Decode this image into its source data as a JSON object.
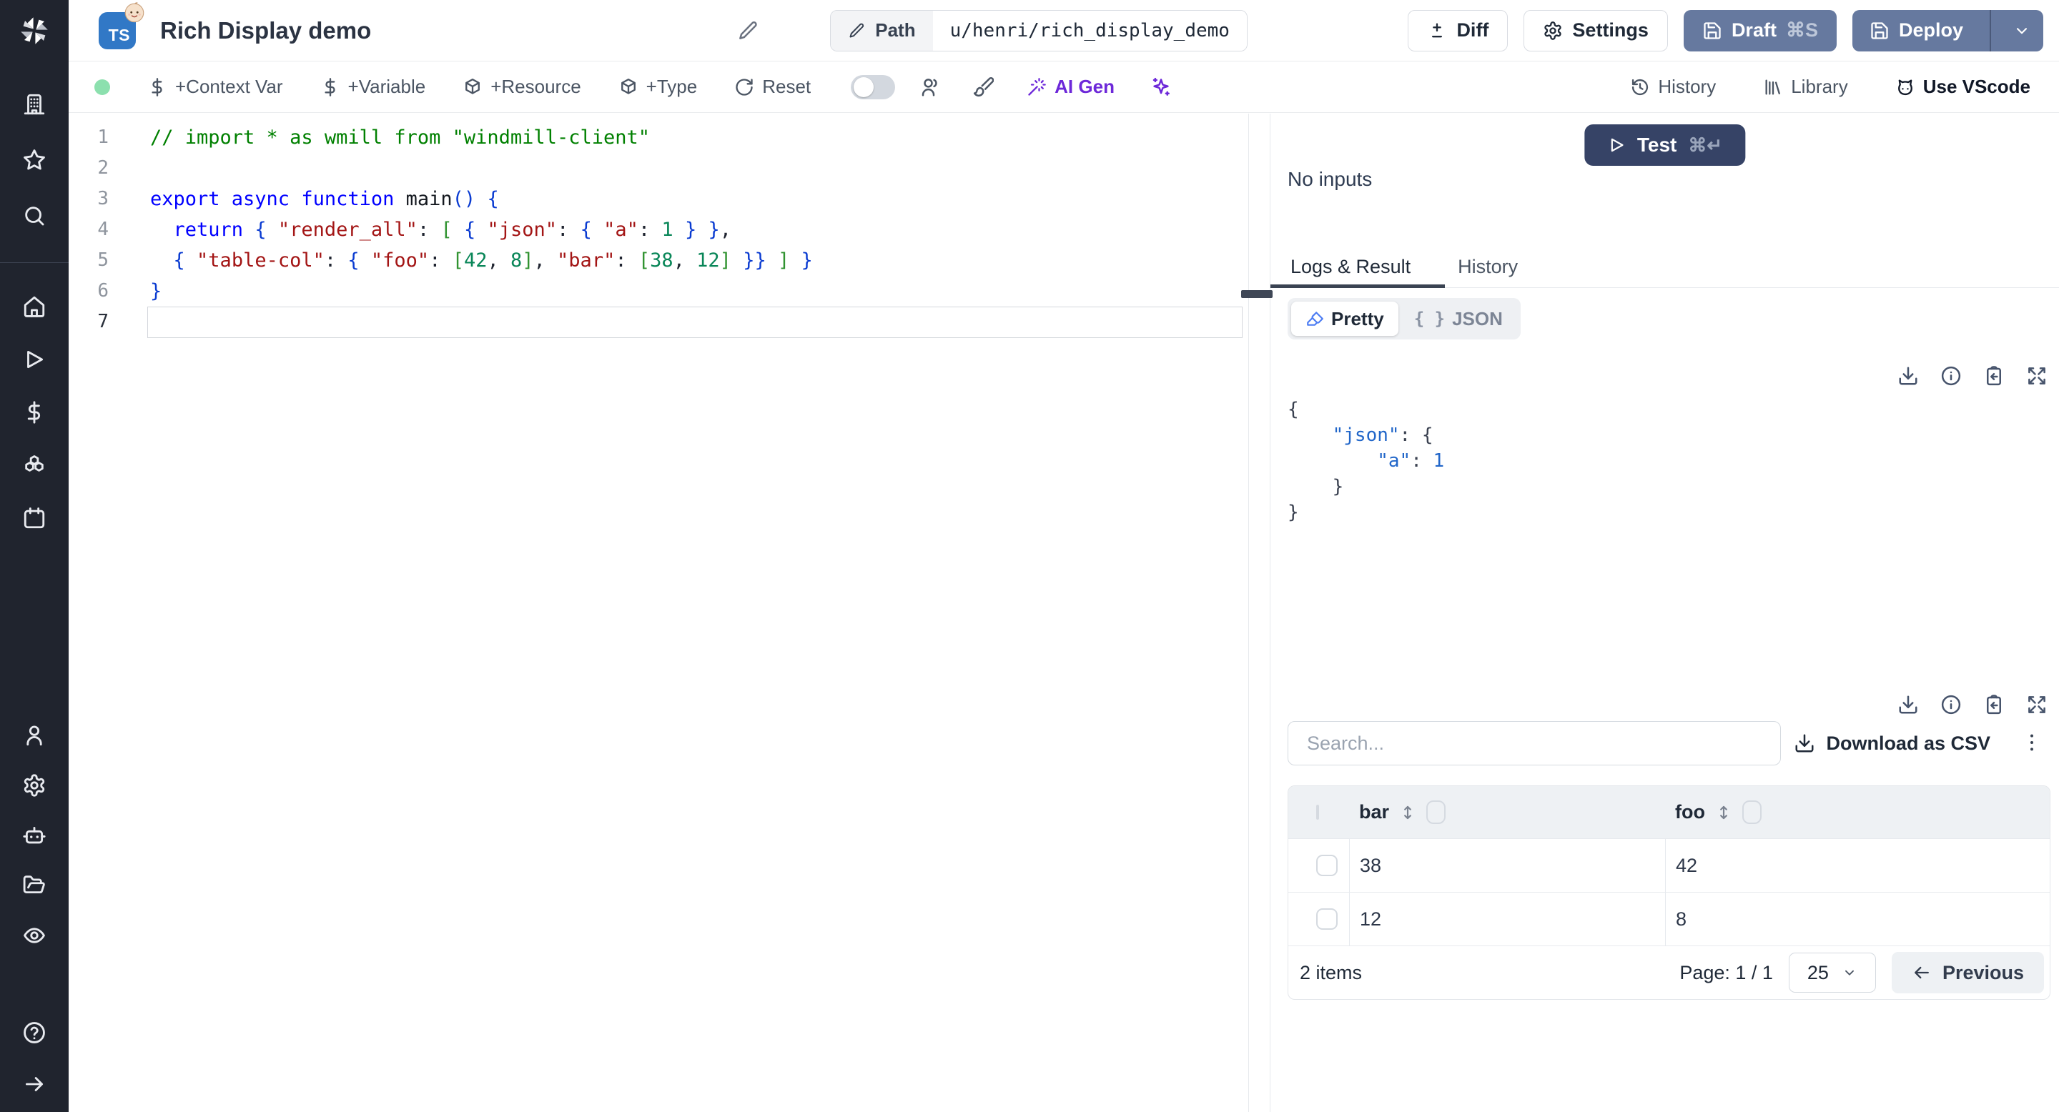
{
  "colors": {
    "accent": "#66799f",
    "navy": "#364366",
    "purple": "#6d28d9",
    "green": "#8ce0ae",
    "ts": "#3178c6"
  },
  "sidebar": {
    "groups": [
      {
        "items": [
          "building-icon",
          "star-icon",
          "search-icon"
        ]
      },
      {
        "items": [
          "home-icon",
          "play-icon",
          "dollar-icon",
          "boxes-icon",
          "calendar-icon"
        ]
      },
      {
        "items": [
          "user-icon",
          "settings-icon",
          "bot-icon",
          "folder-open-icon",
          "eye-icon"
        ]
      },
      {
        "items": [
          "help-icon",
          "arrow-right-icon"
        ]
      }
    ]
  },
  "header": {
    "language_badge": "TS",
    "title": "Rich Display demo",
    "path_label": "Path",
    "path_value": "u/henri/rich_display_demo",
    "diff_label": "Diff",
    "settings_label": "Settings",
    "draft_label": "Draft",
    "draft_shortcut": "⌘S",
    "deploy_label": "Deploy"
  },
  "toolbar": {
    "add_context_var": "+Context Var",
    "add_variable": "+Variable",
    "add_resource": "+Resource",
    "add_type": "+Type",
    "reset": "Reset",
    "ai_gen": "AI Gen",
    "history": "History",
    "library": "Library",
    "use_vscode": "Use VScode"
  },
  "editor": {
    "active_line": 7,
    "lines": [
      {
        "num": 1,
        "segments": [
          [
            "// import * as wmill from \"windmill-client\"",
            "comment"
          ]
        ]
      },
      {
        "num": 2,
        "segments": []
      },
      {
        "num": 3,
        "segments": [
          [
            "export async function ",
            "kw"
          ],
          [
            "main",
            "fn"
          ],
          [
            "()",
            "brc"
          ],
          [
            " ",
            "plain"
          ],
          [
            "{",
            "brc"
          ]
        ]
      },
      {
        "num": 4,
        "segments": [
          [
            "  ",
            "plain"
          ],
          [
            "return",
            "kw"
          ],
          [
            " ",
            "plain"
          ],
          [
            "{",
            "brc"
          ],
          [
            " ",
            "plain"
          ],
          [
            "\"render_all\"",
            "str"
          ],
          [
            ": ",
            "plain"
          ],
          [
            "[",
            "sqr"
          ],
          [
            " ",
            "plain"
          ],
          [
            "{",
            "brc"
          ],
          [
            " ",
            "plain"
          ],
          [
            "\"json\"",
            "str"
          ],
          [
            ": ",
            "plain"
          ],
          [
            "{",
            "brc"
          ],
          [
            " ",
            "plain"
          ],
          [
            "\"a\"",
            "str"
          ],
          [
            ": ",
            "plain"
          ],
          [
            "1",
            "num"
          ],
          [
            " ",
            "plain"
          ],
          [
            "}",
            "brc"
          ],
          [
            " ",
            "plain"
          ],
          [
            "}",
            "brc"
          ],
          [
            ",",
            "plain"
          ]
        ]
      },
      {
        "num": 5,
        "segments": [
          [
            "  ",
            "plain"
          ],
          [
            "{",
            "brc"
          ],
          [
            " ",
            "plain"
          ],
          [
            "\"table-col\"",
            "str"
          ],
          [
            ": ",
            "plain"
          ],
          [
            "{",
            "brc"
          ],
          [
            " ",
            "plain"
          ],
          [
            "\"foo\"",
            "str"
          ],
          [
            ": ",
            "plain"
          ],
          [
            "[",
            "sqr"
          ],
          [
            "42",
            "num"
          ],
          [
            ", ",
            "plain"
          ],
          [
            "8",
            "num"
          ],
          [
            "]",
            "sqr"
          ],
          [
            ", ",
            "plain"
          ],
          [
            "\"bar\"",
            "str"
          ],
          [
            ": ",
            "plain"
          ],
          [
            "[",
            "sqr"
          ],
          [
            "38",
            "num"
          ],
          [
            ", ",
            "plain"
          ],
          [
            "12",
            "num"
          ],
          [
            "]",
            "sqr"
          ],
          [
            " ",
            "plain"
          ],
          [
            "}}",
            "brc"
          ],
          [
            " ",
            "plain"
          ],
          [
            "]",
            "sqr"
          ],
          [
            " ",
            "plain"
          ],
          [
            "}",
            "brc"
          ]
        ]
      },
      {
        "num": 6,
        "segments": [
          [
            "}",
            "brc"
          ]
        ]
      },
      {
        "num": 7,
        "segments": []
      }
    ]
  },
  "run_panel": {
    "test_label": "Test",
    "test_shortcut": "⌘↵",
    "no_inputs": "No inputs",
    "active_tab": "Logs & Result",
    "tabs": [
      "Logs & Result",
      "History"
    ],
    "view_toggle": [
      "Pretty",
      "JSON"
    ],
    "json_badge": "{ }",
    "result_lines": [
      {
        "segments": [
          [
            "{",
            "b"
          ]
        ]
      },
      {
        "segments": [
          [
            "    ",
            "b"
          ],
          [
            "\"json\"",
            "k"
          ],
          [
            ":",
            "b"
          ],
          [
            " ",
            "b"
          ],
          [
            "{",
            "b"
          ]
        ]
      },
      {
        "segments": [
          [
            "        ",
            "b"
          ],
          [
            "\"a\"",
            "k"
          ],
          [
            ":",
            "b"
          ],
          [
            " ",
            "b"
          ],
          [
            "1",
            "k"
          ]
        ]
      },
      {
        "segments": [
          [
            "    ",
            "b"
          ],
          [
            "}",
            "b"
          ]
        ]
      },
      {
        "segments": [
          [
            "}",
            "b"
          ]
        ]
      }
    ],
    "table": {
      "search_placeholder": "Search...",
      "download_csv": "Download as CSV",
      "columns": [
        "bar",
        "foo"
      ],
      "rows": [
        [
          "38",
          "42"
        ],
        [
          "12",
          "8"
        ]
      ],
      "items_label": "2 items",
      "page_label": "Page: 1 / 1",
      "page_size": "25",
      "previous_label": "Previous"
    }
  }
}
